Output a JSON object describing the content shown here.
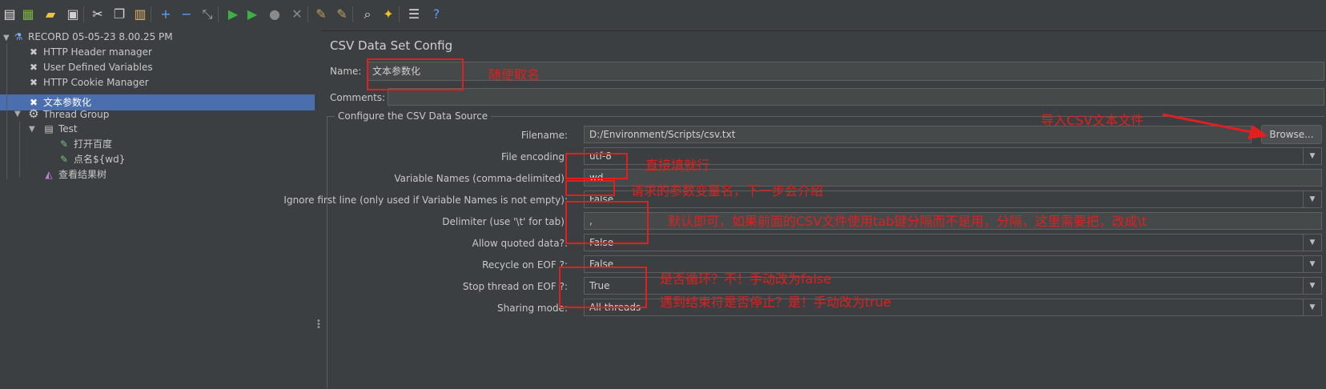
{
  "toolbar": {
    "buttons": [
      {
        "name": "new-icon",
        "glyph": "▤",
        "color": "#e0e0e0"
      },
      {
        "name": "templates-icon",
        "glyph": "▦",
        "color": "#7cb342"
      },
      {
        "name": "open-icon",
        "glyph": "▰",
        "color": "#f0c040"
      },
      {
        "name": "save-icon",
        "glyph": "▣",
        "color": "#cfcfcf"
      },
      {
        "name": "cut-icon",
        "glyph": "✂",
        "color": "#e0e0e0"
      },
      {
        "name": "copy-icon",
        "glyph": "❐",
        "color": "#cfcfcf"
      },
      {
        "name": "paste-icon",
        "glyph": "▥",
        "color": "#e0b060"
      },
      {
        "name": "expand-icon",
        "glyph": "+",
        "color": "#5aa0f0"
      },
      {
        "name": "collapse-icon",
        "glyph": "−",
        "color": "#5aa0f0"
      },
      {
        "name": "toggle-icon",
        "glyph": "⤡",
        "color": "#aaaaaa"
      },
      {
        "name": "start-icon",
        "glyph": "▶",
        "color": "#3cb043"
      },
      {
        "name": "start-no-pauses-icon",
        "glyph": "▶",
        "color": "#3cb043"
      },
      {
        "name": "stop-icon",
        "glyph": "●",
        "color": "#8a8a8a"
      },
      {
        "name": "shutdown-icon",
        "glyph": "✕",
        "color": "#8a8a8a"
      },
      {
        "name": "clear-icon",
        "glyph": "✎",
        "color": "#c0a060"
      },
      {
        "name": "clear-all-icon",
        "glyph": "✎",
        "color": "#c0a060"
      },
      {
        "name": "search-icon",
        "glyph": "⌕",
        "color": "#dddddd"
      },
      {
        "name": "reset-search-icon",
        "glyph": "✦",
        "color": "#f0c020"
      },
      {
        "name": "function-helper-icon",
        "glyph": "☰",
        "color": "#dddddd"
      },
      {
        "name": "help-icon",
        "glyph": "?",
        "color": "#5aa0f0"
      }
    ]
  },
  "tree": {
    "items": [
      {
        "label": "RECORD 05-05-23 8.00.25 PM",
        "icon": "flask-icon",
        "glyph": "⚗",
        "color": "#7fb0ff"
      },
      {
        "label": "HTTP Header manager",
        "icon": "wrench-icon",
        "glyph": "✖",
        "color": "#dddddd"
      },
      {
        "label": "User Defined Variables",
        "icon": "wrench-icon",
        "glyph": "✖",
        "color": "#dddddd"
      },
      {
        "label": "HTTP Cookie Manager",
        "icon": "wrench-icon",
        "glyph": "✖",
        "color": "#dddddd"
      },
      {
        "label": "文本参数化",
        "icon": "wrench-icon",
        "glyph": "✖",
        "color": "#ffffff"
      },
      {
        "label": "Thread Group",
        "icon": "gear-icon",
        "glyph": "⚙",
        "color": "#dddddd"
      },
      {
        "label": "Test",
        "icon": "controller-icon",
        "glyph": "▤",
        "color": "#dddddd"
      },
      {
        "label": "打开百度",
        "icon": "sampler-icon",
        "glyph": "✎",
        "color": "#7cc07c"
      },
      {
        "label": "点名${wd}",
        "icon": "sampler-icon",
        "glyph": "✎",
        "color": "#7cc07c"
      },
      {
        "label": "查看结果树",
        "icon": "listener-icon",
        "glyph": "◭",
        "color": "#c080e0"
      }
    ]
  },
  "panel": {
    "title": "CSV Data Set Config",
    "name_label": "Name:",
    "name_value": "文本参数化",
    "comments_label": "Comments:",
    "comments_value": "",
    "group_title": "Configure the CSV Data Source",
    "filename_label": "Filename:",
    "filename_value": "D:/Environment/Scripts/csv.txt",
    "browse_label": "Browse...",
    "encoding_label": "File encoding:",
    "encoding_value": "utf-8",
    "varnames_label": "Variable Names (comma-delimited):",
    "varnames_value": "wd",
    "ignore_label": "Ignore first line (only used if Variable Names is not empty):",
    "ignore_value": "False",
    "delimiter_label": "Delimiter (use '\\t' for tab):",
    "delimiter_value": ",",
    "quoted_label": "Allow quoted data?:",
    "quoted_value": "False",
    "recycle_label": "Recycle on EOF ?:",
    "recycle_value": "False",
    "stop_label": "Stop thread on EOF ?:",
    "stop_value": "True",
    "sharing_label": "Sharing mode:",
    "sharing_value": "All threads"
  },
  "annotations": {
    "name_note": "随便取名",
    "import_note": "导入CSV文本文件",
    "encoding_note": "直接填就行",
    "varnames_note": "请求的参数变量名，下一步会介绍",
    "delimiter_note": "默认即可，如果前面的CSV文件使用tab键分隔而不是用，分隔，这里需要把，改成\\t",
    "recycle_note": "是否循环？不！手动改为false",
    "stop_note": "遇到结束符是否停止？是！手动改为true",
    "color": "#e02020"
  },
  "colors": {
    "background": "#3c3f41",
    "selection": "#4b6eaf",
    "field": "#45494a"
  }
}
